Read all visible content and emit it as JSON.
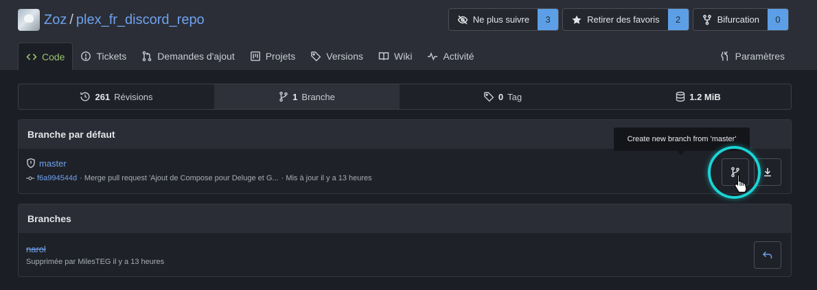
{
  "repo": {
    "owner": "Zoz",
    "separator": "/",
    "name": "plex_fr_discord_repo"
  },
  "actions": [
    {
      "label": "Ne plus suivre",
      "count": "3",
      "icon": "eye-off-icon"
    },
    {
      "label": "Retirer des favoris",
      "count": "2",
      "icon": "star-icon"
    },
    {
      "label": "Bifurcation",
      "count": "0",
      "icon": "fork-icon"
    }
  ],
  "tabs": {
    "code": "Code",
    "tickets": "Tickets",
    "pulls": "Demandes d'ajout",
    "projects": "Projets",
    "versions": "Versions",
    "wiki": "Wiki",
    "activity": "Activité",
    "settings": "Paramètres"
  },
  "stats": {
    "commits": {
      "count": "261",
      "label": "Révisions"
    },
    "branches": {
      "count": "1",
      "label": "Branche"
    },
    "tags": {
      "count": "0",
      "label": "Tag"
    },
    "size": {
      "count": "1.2 MiB"
    }
  },
  "default_branch": {
    "heading": "Branche par défaut",
    "name": "master",
    "sha": "f6a994544d",
    "message": "· Merge pull request 'Ajout de Compose pour Deluge et G...",
    "updated": "· Mis à jour il y a 13 heures",
    "tooltip": "Create new branch from 'master'"
  },
  "branches": {
    "heading": "Branches",
    "items": [
      {
        "name": "narol",
        "status": "Supprimée par MilesTEG il y a 13 heures"
      }
    ]
  },
  "colors": {
    "accent": "#6ea2ee",
    "active_tab": "#99c46b",
    "count_badge": "#5d9fe6",
    "highlight_ring": "#1ad4d4"
  }
}
